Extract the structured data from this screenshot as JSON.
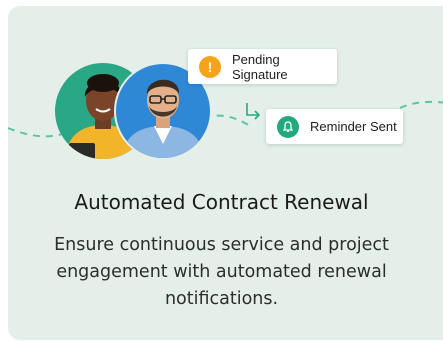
{
  "card": {
    "background": "#e4efe9",
    "title": "Automated Contract Renewal",
    "description": "Ensure continuous service and project engagement with automated renewal notifications."
  },
  "status_pills": [
    {
      "label": "Pending Signature",
      "icon": "warning-icon",
      "icon_color": "#f4a31a"
    },
    {
      "label": "Reminder Sent",
      "icon": "bell-icon",
      "icon_color": "#23a97f"
    }
  ],
  "avatars": [
    {
      "name": "woman-avatar",
      "background": "#2aa784"
    },
    {
      "name": "man-avatar",
      "background": "#2f88d6"
    }
  ],
  "accent_dash_color": "#5fc2a6"
}
